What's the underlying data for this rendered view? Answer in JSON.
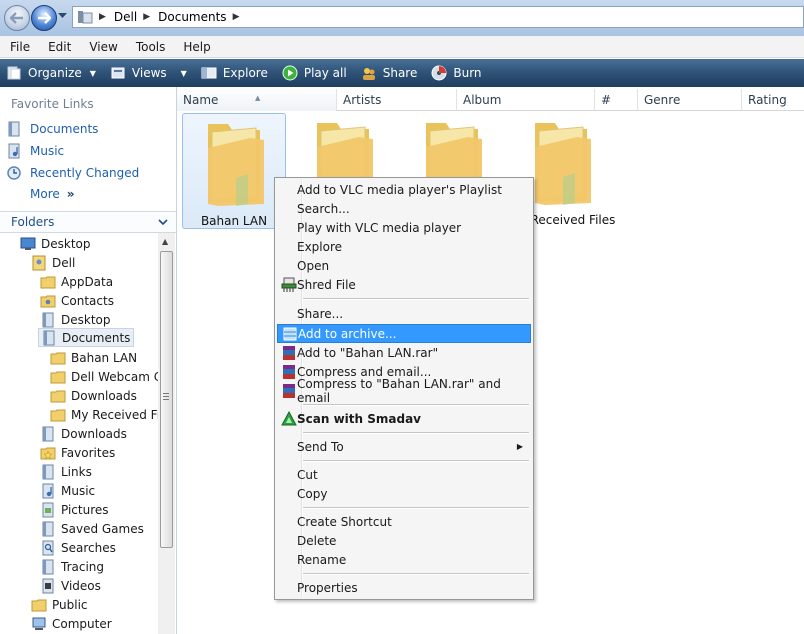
{
  "address": {
    "crumbs": [
      "Dell",
      "Documents"
    ]
  },
  "menubar": [
    "File",
    "Edit",
    "View",
    "Tools",
    "Help"
  ],
  "command_bar": {
    "organize": "Organize",
    "views": "Views",
    "explore": "Explore",
    "play_all": "Play all",
    "share": "Share",
    "burn": "Burn"
  },
  "favorite_links": {
    "title": "Favorite Links",
    "items": [
      "Documents",
      "Music",
      "Recently Changed"
    ],
    "more": "More"
  },
  "folders_header": "Folders",
  "tree": [
    "Desktop",
    "Dell",
    "AppData",
    "Contacts",
    "Desktop",
    "Documents",
    "Bahan LAN",
    "Dell Webcam Ce",
    "Downloads",
    "My Received File",
    "Downloads",
    "Favorites",
    "Links",
    "Music",
    "Pictures",
    "Saved Games",
    "Searches",
    "Tracing",
    "Videos",
    "Public",
    "Computer"
  ],
  "columns": [
    "Name",
    "Artists",
    "Album",
    "#",
    "Genre",
    "Rating"
  ],
  "files": [
    "Bahan LAN",
    "",
    "",
    "Received Files"
  ],
  "context_menu": [
    "Add to VLC media player's Playlist",
    "Search...",
    "Play with VLC media player",
    "Explore",
    "Open",
    "Shred File",
    "Share...",
    "Add to archive...",
    "Add to \"Bahan LAN.rar\"",
    "Compress and email...",
    "Compress to \"Bahan LAN.rar\" and email",
    "Scan with Smadav",
    "Send To",
    "Cut",
    "Copy",
    "Create Shortcut",
    "Delete",
    "Rename",
    "Properties"
  ],
  "colors": {
    "accent": "#3399ff",
    "link": "#1f5fae",
    "command_bar": "#2c4f74"
  }
}
